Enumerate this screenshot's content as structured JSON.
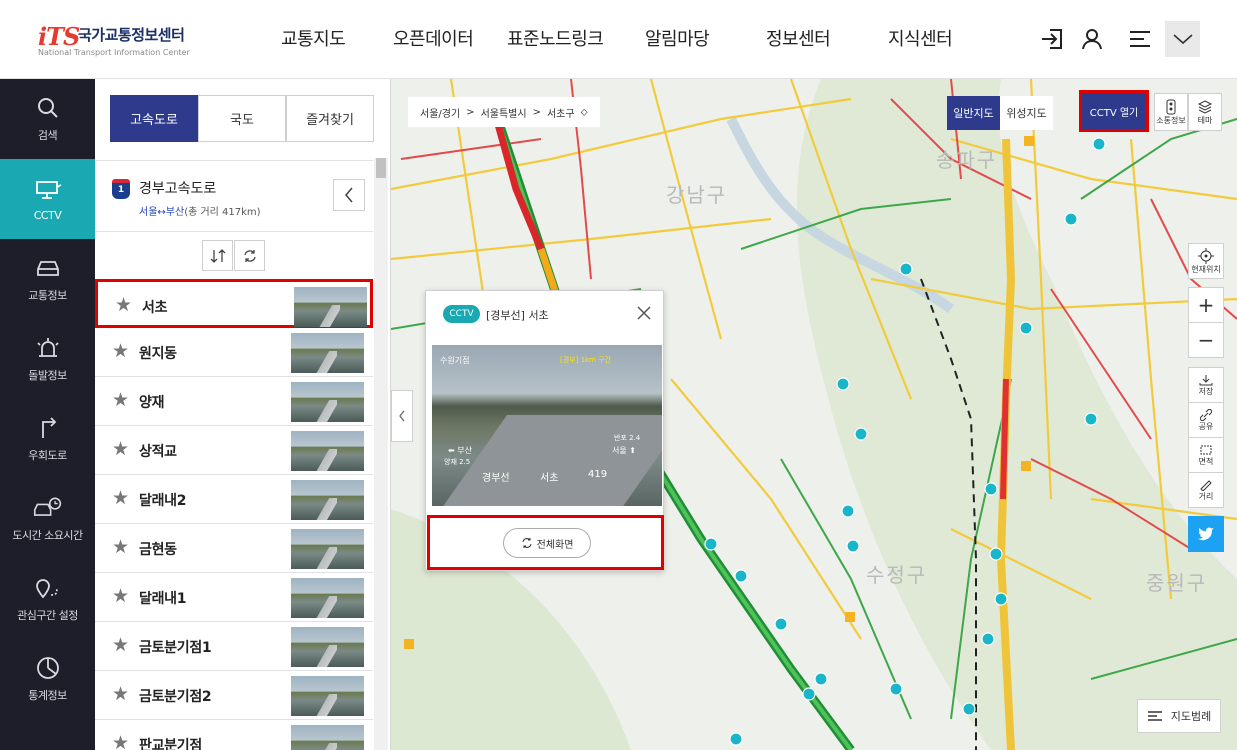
{
  "header": {
    "logo_mark": "iTS",
    "logo_name": "국가교통정보센터",
    "logo_sub": "National Transport Information Center",
    "menu": [
      "교통지도",
      "오픈데이터",
      "표준노드링크",
      "알림마당",
      "정보센터",
      "지식센터"
    ],
    "icons": [
      "login-icon",
      "user-icon",
      "menu-icon",
      "chevron-down-icon"
    ]
  },
  "leftnav": {
    "items": [
      {
        "label": "검색",
        "icon": "search-icon"
      },
      {
        "label": "CCTV",
        "icon": "cctv-icon",
        "active": true
      },
      {
        "label": "교통정보",
        "icon": "car-icon"
      },
      {
        "label": "돌발정보",
        "icon": "alert-light-icon"
      },
      {
        "label": "우회도로",
        "icon": "detour-icon"
      },
      {
        "label": "도시간 소요시간",
        "icon": "car-clock-icon"
      },
      {
        "label": "관심구간 설정",
        "icon": "pin-route-icon"
      },
      {
        "label": "통계정보",
        "icon": "stats-icon"
      }
    ]
  },
  "panel": {
    "tabs": [
      {
        "label": "고속도로",
        "active": true
      },
      {
        "label": "국도"
      },
      {
        "label": "즐겨찾기"
      }
    ],
    "road": {
      "number": "1",
      "name": "경부고속도로",
      "route": "서울↔부산",
      "distance": "(총 거리 417km)"
    },
    "cctv_list": [
      {
        "name": "서초",
        "selected": true
      },
      {
        "name": "원지동"
      },
      {
        "name": "양재"
      },
      {
        "name": "상적교"
      },
      {
        "name": "달래내2"
      },
      {
        "name": "금현동"
      },
      {
        "name": "달래내1"
      },
      {
        "name": "금토분기점1"
      },
      {
        "name": "금토분기점2"
      },
      {
        "name": "판교분기점"
      }
    ]
  },
  "map": {
    "breadcrumb": [
      "서울/경기",
      "서울특별시",
      "서초구"
    ],
    "map_types": [
      {
        "label": "일반지도",
        "active": true
      },
      {
        "label": "위성지도"
      }
    ],
    "cctv_open_label": "CCTV 열기",
    "tools_top": [
      {
        "label": "소통정보",
        "icon": "traffic-icon"
      },
      {
        "label": "테마",
        "icon": "layers-icon"
      }
    ],
    "location_label": "현재위치",
    "zoom_in": "+",
    "zoom_out": "−",
    "tools": [
      {
        "label": "저장",
        "icon": "download-icon"
      },
      {
        "label": "공유",
        "icon": "link-icon"
      },
      {
        "label": "면적",
        "icon": "area-icon"
      },
      {
        "label": "거리",
        "icon": "ruler-icon"
      }
    ],
    "legend_label": "지도범례",
    "districts": [
      "강남구",
      "송파구",
      "수정구",
      "중원구"
    ]
  },
  "popup": {
    "badge": "CCTV",
    "title": "[경부선] 서초",
    "video": {
      "left_top": "수원기점",
      "caption": "[경부] 1km 구간",
      "left_dir": "⬅ 부산",
      "left_dist": "양재 2.5",
      "right_top": "반포 2.4",
      "right_dir": "서울 ⬆",
      "road": "경부선",
      "place": "서초",
      "km": "419"
    },
    "fullscreen_label": "전체화면"
  },
  "colors": {
    "primary": "#2e3a8c",
    "accent": "#1aa9b2",
    "nav_bg": "#1e1e2a",
    "highlight": "#e00000"
  }
}
